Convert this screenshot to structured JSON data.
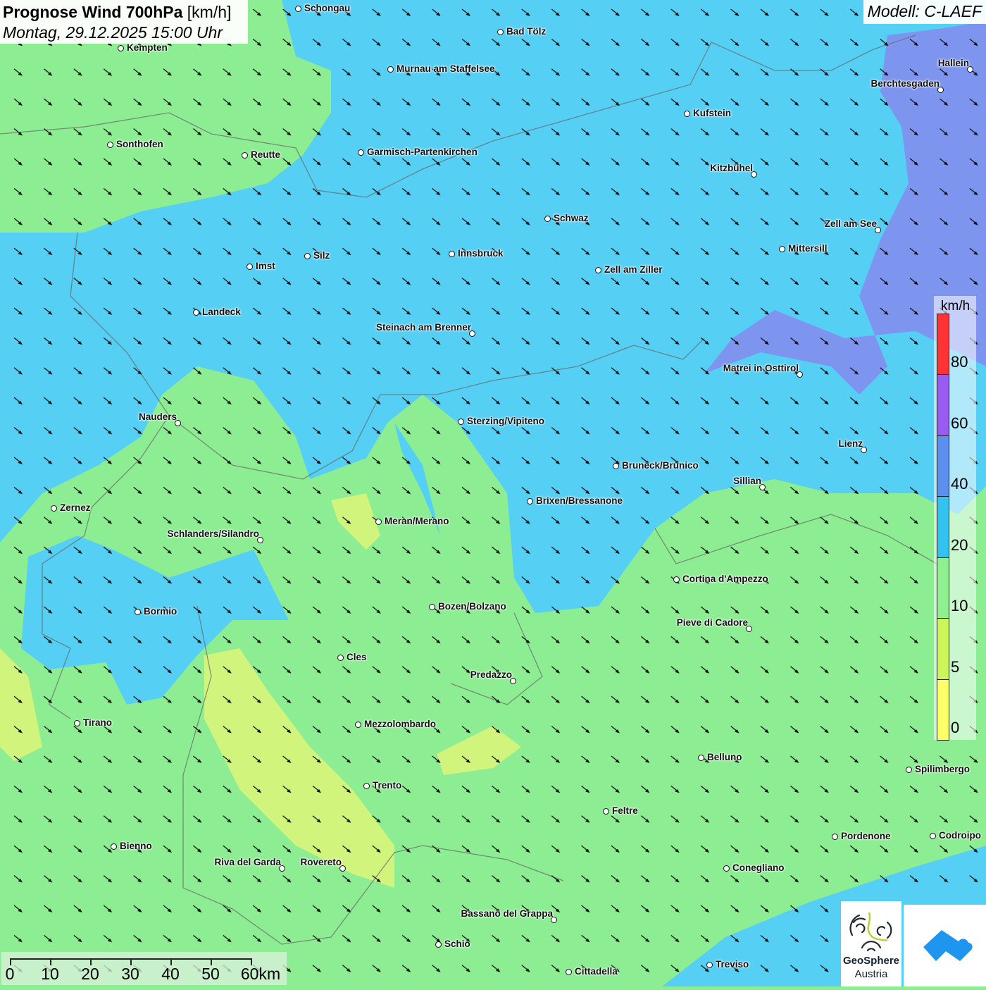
{
  "header": {
    "title_bold": "Prognose Wind 700hPa",
    "title_unit": "[km/h]",
    "datetime": "Montag, 29.12.2025 15:00 Uhr",
    "model": "Modell: C-LAEF"
  },
  "legend": {
    "unit": "km/h",
    "bands": [
      {
        "label": "0",
        "color": "#ffff66"
      },
      {
        "label": "5",
        "color": "#ccf55a"
      },
      {
        "label": "10",
        "color": "#8ef08e"
      },
      {
        "label": "20",
        "color": "#33c3f0"
      },
      {
        "label": "40",
        "color": "#5c8ff0"
      },
      {
        "label": "60",
        "color": "#9a5cf0"
      },
      {
        "label": "80",
        "color": "#ff3333"
      }
    ]
  },
  "scale_bar": {
    "labels": [
      "0",
      "10",
      "20",
      "30",
      "40",
      "50",
      "60km"
    ]
  },
  "logos": {
    "geosphere_line1": "GeoSphere",
    "geosphere_line2": "Austria"
  },
  "colors": {
    "calm_yellow": "#e6f57a",
    "green": "#8ded92",
    "cyan": "#56cff4",
    "blue": "#7e95f0"
  },
  "wind_direction": "northwest-to-southeast",
  "cities": [
    "Schongau",
    "Bad Tölz",
    "Kempten",
    "Murnau am Staffelsee",
    "Hallein",
    "Berchtesgaden",
    "Kufstein",
    "Sonthofen",
    "Reutte",
    "Garmisch-Partenkirchen",
    "Kitzbühel",
    "Schwaz",
    "Zell am See",
    "Mittersill",
    "Silz",
    "Innsbruck",
    "Imst",
    "Zell am Ziller",
    "Landeck",
    "Steinach am Brenner",
    "Matrei in Osttirol",
    "Nauders",
    "Sterzing/Vipiteno",
    "Lienz",
    "Bruneck/Brunico",
    "Sillian",
    "Brixen/Bressanone",
    "Zernez",
    "Meran/Merano",
    "Schlanders/Silandro",
    "Cortina d'Ampezzo",
    "Bozen/Bolzano",
    "Bormio",
    "Pieve di Cadore",
    "Cles",
    "Predazzo",
    "Tirano",
    "Mezzolombardo",
    "Belluno",
    "Spilimbergo",
    "Trento",
    "Feltre",
    "Pordenone",
    "Codroipo",
    "Bienno",
    "Riva del Garda",
    "Rovereto",
    "Conegliano",
    "Bassano del Grappa",
    "Schio",
    "Treviso",
    "Cittadella"
  ]
}
